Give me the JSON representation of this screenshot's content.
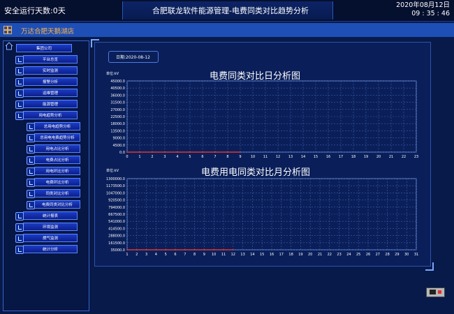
{
  "header": {
    "safe_days": "安全运行天数:0天",
    "title": "合肥联龙软件能源管理-电费同类对比趋势分析",
    "date": "2020年08月12日",
    "time": "09 : 35 : 46"
  },
  "subheader": {
    "location": "万达合肥天鹅湖店"
  },
  "sidebar": {
    "root": "集团公司",
    "items": [
      "平台总览",
      "实时监测",
      "报警分析",
      "运维管理",
      "能源管理",
      "用电趋势分析",
      "总用电趋势分析",
      "总用电电费趋势分析",
      "用电占比分析",
      "电费占比分析",
      "用电环比分析",
      "电费环比分析",
      "同类对比分析",
      "电费同类对比分析",
      "统计报表",
      "环境监测",
      "燃气监测",
      "统计分析"
    ]
  },
  "date_box": {
    "label": "日期:2020-08-12"
  },
  "accent_colors": {
    "series": "#ff3d2e",
    "grid": "#3c5da8"
  },
  "chart_data": [
    {
      "type": "line",
      "title": "电费同类对比日分析图",
      "unit": "单位:kV",
      "ylim": [
        0,
        45000
      ],
      "yticks": [
        "45000.0",
        "40500.0",
        "36000.0",
        "31500.0",
        "27000.0",
        "22500.0",
        "18000.0",
        "13500.0",
        "9000.0",
        "4500.0",
        "0.0"
      ],
      "x": [
        0,
        1,
        2,
        3,
        4,
        5,
        6,
        7,
        8,
        9,
        10,
        11,
        12,
        13,
        14,
        15,
        16,
        17,
        18,
        19,
        20,
        21,
        22,
        23
      ],
      "series": [
        {
          "values": [
            0,
            0,
            0,
            0,
            0,
            0,
            0,
            0,
            0,
            0
          ]
        }
      ],
      "grid": true
    },
    {
      "type": "line",
      "title": "电费用电同类对比月分析图",
      "unit": "单位:kV",
      "ylim": [
        35000,
        1300000
      ],
      "yticks": [
        "1300000.0",
        "1173500.0",
        "1047000.0",
        "920500.0",
        "794000.0",
        "667500.0",
        "541000.0",
        "414500.0",
        "288000.0",
        "161500.0",
        "35000.0"
      ],
      "x": [
        1,
        2,
        3,
        4,
        5,
        6,
        7,
        8,
        9,
        10,
        11,
        12,
        13,
        14,
        15,
        16,
        17,
        18,
        19,
        20,
        21,
        22,
        23,
        24,
        25,
        26,
        27,
        28,
        29,
        30,
        31
      ],
      "series": [
        {
          "values": [
            35000,
            35000,
            35000,
            35000,
            35000,
            35000,
            35000,
            35000,
            35000,
            35000,
            35000,
            35000
          ]
        }
      ],
      "grid": true
    }
  ]
}
